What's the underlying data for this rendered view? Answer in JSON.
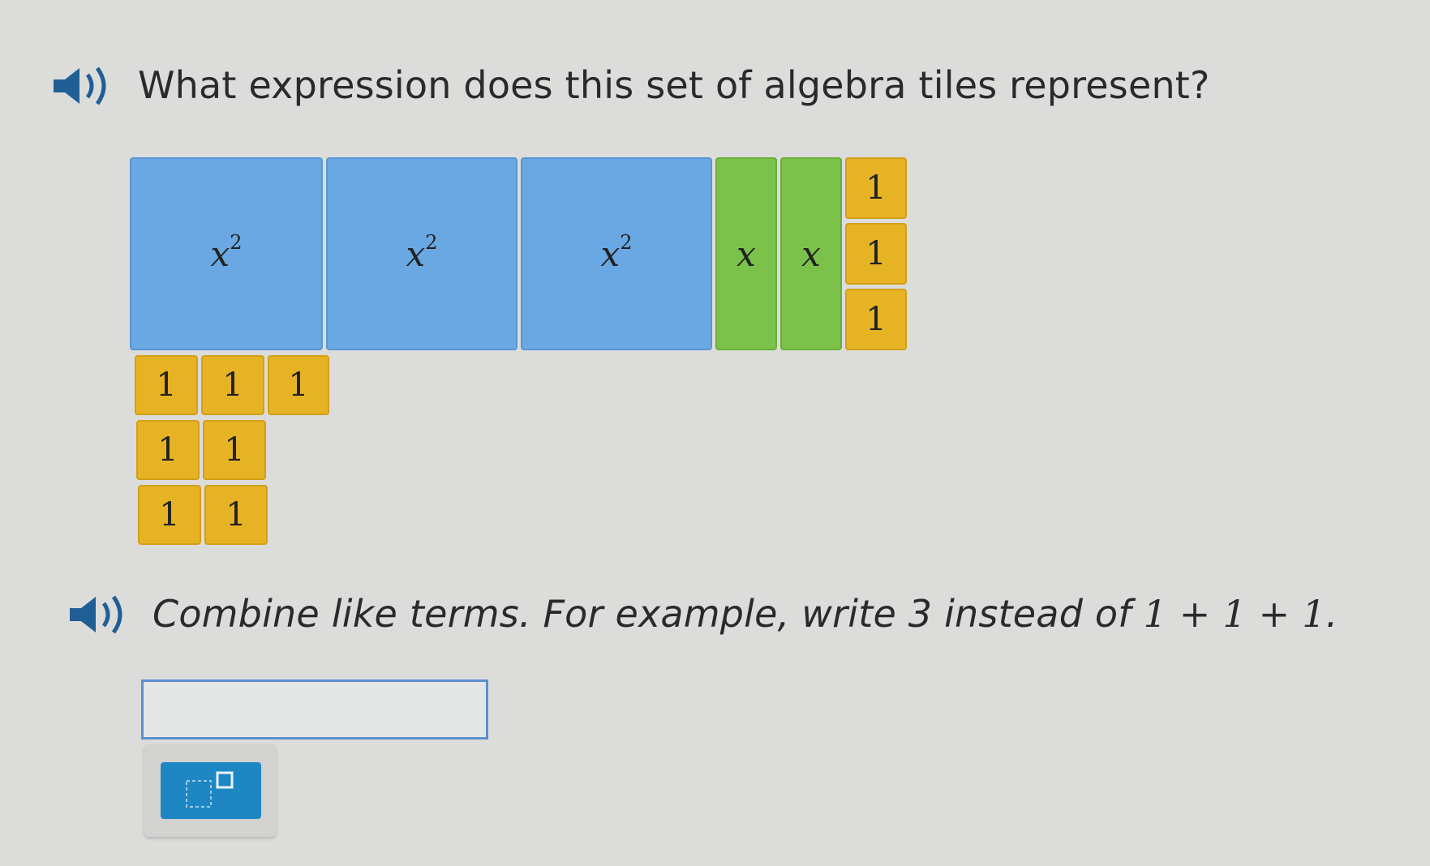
{
  "question": {
    "text": "What expression does this set of algebra tiles represent?",
    "speaker_icon": "speaker-icon"
  },
  "tiles": {
    "squares": [
      {
        "label_base": "x",
        "label_exp": "2"
      },
      {
        "label_base": "x",
        "label_exp": "2"
      },
      {
        "label_base": "x",
        "label_exp": "2"
      }
    ],
    "x_tiles": [
      {
        "label": "x"
      },
      {
        "label": "x"
      }
    ],
    "unit_tiles": [
      {
        "label": "1"
      },
      {
        "label": "1"
      },
      {
        "label": "1"
      },
      {
        "label": "1"
      },
      {
        "label": "1"
      },
      {
        "label": "1"
      },
      {
        "label": "1"
      },
      {
        "label": "1"
      },
      {
        "label": "1"
      },
      {
        "label": "1"
      }
    ],
    "colors": {
      "square": "#6aa8e4",
      "x": "#7cc24a",
      "unit": "#e6b324"
    }
  },
  "instruction": {
    "text_before": "Combine like terms. For example, write 3 instead of ",
    "math": "1 + 1 + 1",
    "text_after": "."
  },
  "answer": {
    "value": "",
    "placeholder": ""
  },
  "keypad": {
    "exponent_button_icon": "exponent-icon",
    "accent": "#1f86c4"
  }
}
